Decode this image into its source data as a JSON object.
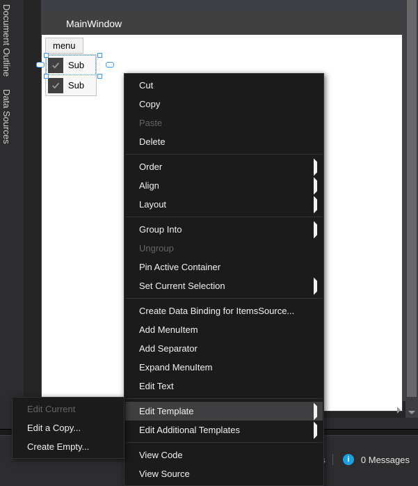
{
  "sidebar": {
    "tabs": [
      "Document Outline",
      "Data Sources"
    ]
  },
  "designer": {
    "window_title": "MainWindow",
    "menu_label": "menu",
    "sub_items": [
      "Sub",
      "Sub"
    ]
  },
  "context_main": {
    "items": [
      {
        "label": "Cut"
      },
      {
        "label": "Copy"
      },
      {
        "label": "Paste",
        "disabled": true
      },
      {
        "label": "Delete"
      },
      {
        "sep": true
      },
      {
        "label": "Order",
        "submenu": true
      },
      {
        "label": "Align",
        "submenu": true
      },
      {
        "label": "Layout",
        "submenu": true
      },
      {
        "sep": true
      },
      {
        "label": "Group Into",
        "submenu": true
      },
      {
        "label": "Ungroup",
        "disabled": true
      },
      {
        "label": "Pin Active Container"
      },
      {
        "label": "Set Current Selection",
        "submenu": true
      },
      {
        "sep": true
      },
      {
        "label": "Create Data Binding for ItemsSource..."
      },
      {
        "label": "Add MenuItem"
      },
      {
        "label": "Add Separator"
      },
      {
        "label": "Expand MenuItem"
      },
      {
        "label": "Edit Text"
      },
      {
        "sep": true
      },
      {
        "label": "Edit Template",
        "submenu": true,
        "highlight": true
      },
      {
        "label": "Edit Additional Templates",
        "submenu": true
      },
      {
        "sep": true
      },
      {
        "label": "View Code"
      },
      {
        "label": "View Source"
      }
    ]
  },
  "context_sub": {
    "items": [
      {
        "label": "Edit Current",
        "disabled": true
      },
      {
        "label": "Edit a Copy..."
      },
      {
        "label": "Create Empty..."
      }
    ]
  },
  "status": {
    "trailing_fragment": "s",
    "messages_count": 0,
    "messages_label": "Messages"
  }
}
